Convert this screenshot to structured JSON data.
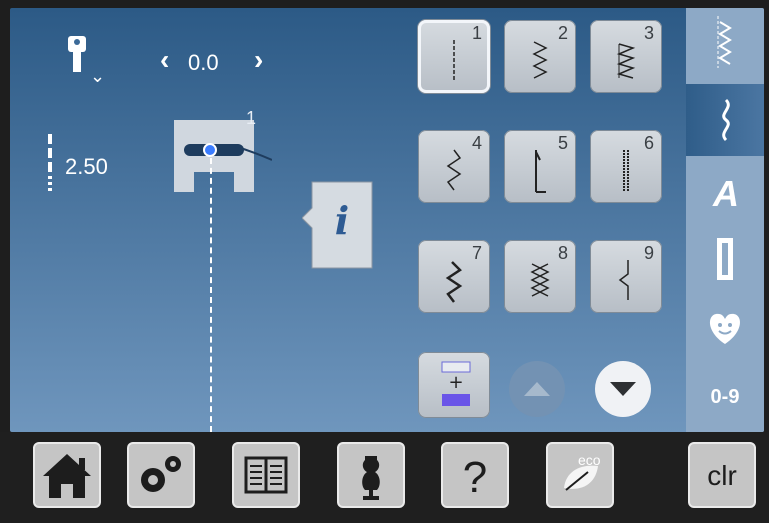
{
  "status": {
    "needle_position": "0.0",
    "stitch_length": "2.50",
    "presser_foot": "1"
  },
  "stitches": [
    {
      "number": "1",
      "icon": "straight-stitch"
    },
    {
      "number": "2",
      "icon": "zigzag-stitch"
    },
    {
      "number": "3",
      "icon": "vari-overlock-stitch"
    },
    {
      "number": "4",
      "icon": "running-stitch"
    },
    {
      "number": "5",
      "icon": "securing-stitch"
    },
    {
      "number": "6",
      "icon": "triple-straight-stitch"
    },
    {
      "number": "7",
      "icon": "triple-zigzag-stitch"
    },
    {
      "number": "8",
      "icon": "honeycomb-stitch"
    },
    {
      "number": "9",
      "icon": "blind-stitch"
    }
  ],
  "side_tabs": [
    {
      "name": "practical-stitches"
    },
    {
      "name": "decorative-stitches"
    },
    {
      "name": "alphabets"
    },
    {
      "name": "buttonholes"
    },
    {
      "name": "personal-program"
    },
    {
      "name": "quick-select",
      "label": "0-9"
    }
  ],
  "bottom_bar": [
    {
      "name": "home"
    },
    {
      "name": "setup"
    },
    {
      "name": "tutorial"
    },
    {
      "name": "sewing-consultant"
    },
    {
      "name": "help"
    },
    {
      "name": "eco",
      "label": "eco"
    },
    {
      "name": "clear",
      "label": "clr"
    }
  ]
}
